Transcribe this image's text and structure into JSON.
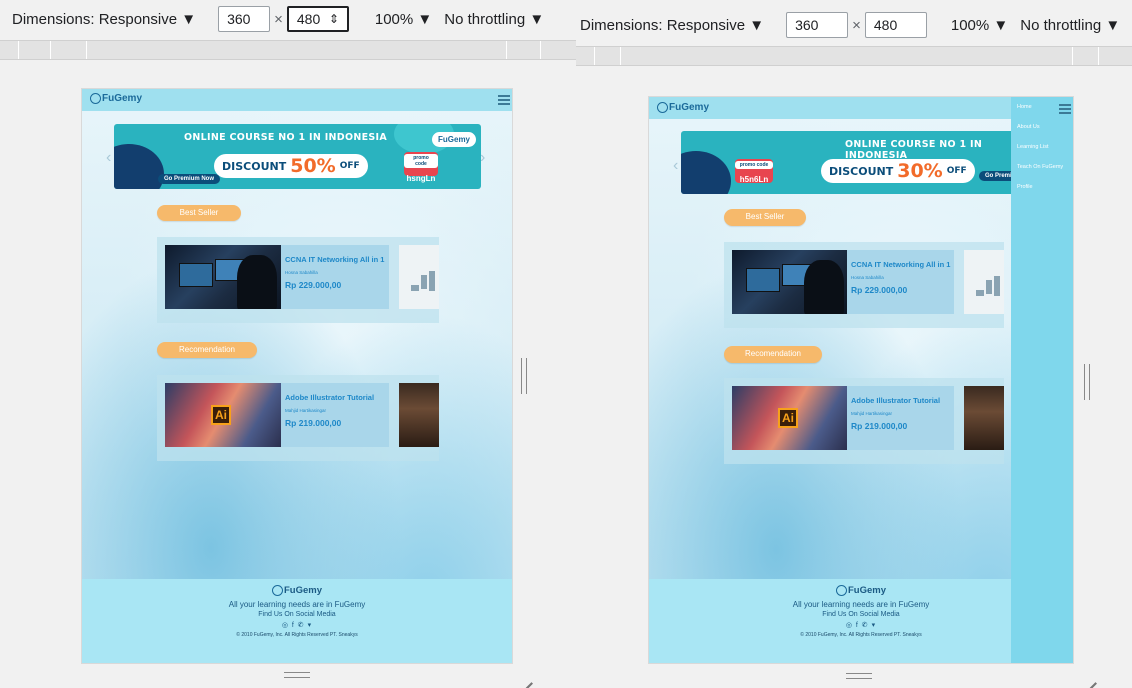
{
  "devtools": {
    "dimensions_label": "Dimensions: Responsive",
    "dropdown_arrow": "▼",
    "width": "360",
    "height": "480",
    "times": "×",
    "zoom": "100%",
    "throttling": "No throttling",
    "spin": "⇕"
  },
  "site": {
    "logo_text": "FuGemy",
    "banner_left": {
      "headline": "ONLINE COURSE NO 1 IN INDONESIA",
      "discount_word": "DISCOUNT",
      "discount_pct": "50%",
      "off": "OFF",
      "go_premium": "Go Premium Now",
      "promo_label": "promo code",
      "promo_code": "hsngLn",
      "banner_logo": "FuGemy"
    },
    "banner_right": {
      "headline": "ONLINE COURSE NO 1 IN INDONESIA",
      "discount_word": "DISCOUNT",
      "discount_pct": "30%",
      "off": "OFF",
      "go_premium": "Go Premium Now",
      "promo_label": "promo code",
      "promo_code": "h5n6Ln"
    },
    "best_seller_label": "Best Seller",
    "recommendation_label": "Recomendation",
    "best_seller_course": {
      "title": "CCNA IT Networking All in 1",
      "author": "Hosna Sabahilla",
      "price": "Rp 229.000,00"
    },
    "recommended_course": {
      "title": "Adobe Illustrator Tutorial",
      "author": "Mahjid Hartikasingar",
      "price": "Rp 219.000,00",
      "thumb_text": "Ai"
    },
    "footer": {
      "logo_text": "FuGemy",
      "tagline": "All your learning needs are in FuGemy",
      "social_label": "Find Us On Social Media",
      "social_icons": "◎ f ✆ ▾",
      "copyright": "© 2010 FuGemy, Inc. All Rights Reserved PT. Sneakys"
    },
    "menu": [
      "Home",
      "About Us",
      "Learning List",
      "Teach On FuGemy",
      "Profile"
    ],
    "prev_arrow": "‹",
    "next_arrow": "›"
  }
}
